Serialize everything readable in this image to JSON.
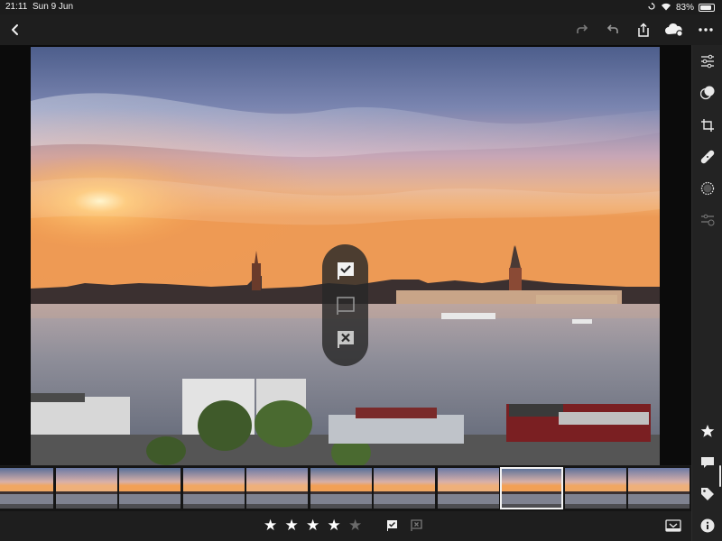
{
  "status_bar": {
    "time": "21:11",
    "date": "Sun 9 Jun",
    "battery_text": "83%",
    "battery_level": 0.83
  },
  "top_bar": {
    "icons": [
      "back-icon",
      "redo-icon",
      "undo-icon",
      "share-icon",
      "cloud-sync-icon",
      "more-icon"
    ]
  },
  "flag_overlay": {
    "options": [
      "pick-flag-icon",
      "unflag-icon",
      "reject-flag-icon"
    ]
  },
  "tool_panel": {
    "tools": [
      "edit-sliders-icon",
      "presets-icon",
      "crop-icon",
      "healing-icon",
      "selective-icon",
      "versions-icon",
      "rating-star-icon",
      "comment-icon",
      "tag-icon",
      "info-icon"
    ]
  },
  "filmstrip": {
    "count": 11,
    "selected_index": 8
  },
  "bottom_bar": {
    "rating": 4,
    "max_rating": 5,
    "icons": [
      "pick-flag-icon",
      "reject-flag-icon",
      "filmstrip-toggle-icon"
    ]
  },
  "colors": {
    "accent": "#ffffff",
    "star_on": "#ffffff",
    "star_off": "#6a6a6a",
    "panel_bg": "#1e1e1e"
  }
}
